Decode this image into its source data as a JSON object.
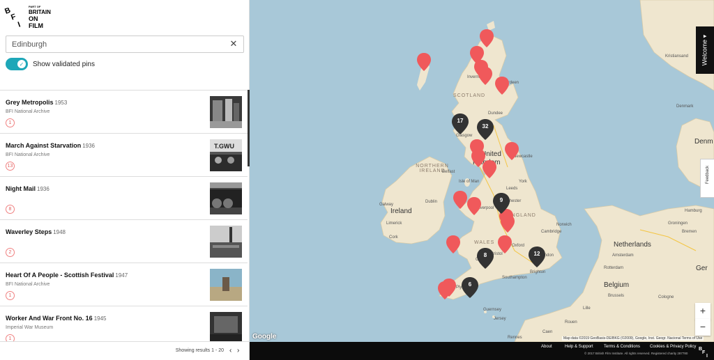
{
  "logo": {
    "top": "PART OF",
    "lines": [
      "BRITAIN",
      "ON",
      "FILM"
    ],
    "bfi": "BFI"
  },
  "search": {
    "value": "Edinburgh",
    "clear_icon": "close-icon"
  },
  "toggle": {
    "label": "Show validated pins",
    "on": true
  },
  "results": [
    {
      "title": "Grey Metropolis",
      "year": "1953",
      "source": "BFI National Archive",
      "count": "1"
    },
    {
      "title": "March Against Starvation",
      "year": "1936",
      "source": "BFI National Archive",
      "count": "13"
    },
    {
      "title": "Night Mail",
      "year": "1936",
      "source": "",
      "count": "8"
    },
    {
      "title": "Waverley Steps",
      "year": "1948",
      "source": "",
      "count": "2"
    },
    {
      "title": "Heart Of A People - Scottish Festival",
      "year": "1947",
      "source": "BFI National Archive",
      "count": "1"
    },
    {
      "title": "Worker And War Front No. 16",
      "year": "1945",
      "source": "Imperial War Museum",
      "count": "1"
    }
  ],
  "pagination": {
    "showing": "Showing results 1 - 20",
    "prev": "‹",
    "next": "›"
  },
  "collapse": "◂",
  "map": {
    "labels": {
      "scotland": "SCOTLAND",
      "glasgow": "Glasgow",
      "edinburgh": "Ed",
      "united_kingdom": "United",
      "kingdom": "Kingdom",
      "northern_ireland": "NORTHERN IRELAND",
      "isle_of_man": "Isle of Man",
      "ireland": "Ireland",
      "dublin": "Dublin",
      "galway": "Galway",
      "leeds": "Leeds",
      "manchester": "Manchester",
      "liverpool": "Liverpool",
      "england": "ENGLAND",
      "wales": "WALES",
      "cambridge": "Cambridge",
      "oxford": "Oxford",
      "london": "London",
      "southampton": "Southampton",
      "brighton": "Brighton",
      "guernsey": "Guernsey",
      "jersey": "Jersey",
      "caen": "Caen",
      "denmark": "Denm",
      "netherlands": "Netherlands",
      "belgium": "Belgium",
      "amsterdam": "Amsterdam",
      "brussels": "Brussels",
      "hamburg": "Hamburg",
      "german": "Ger",
      "rouen": "Rouen",
      "rennes": "Rennes",
      "norway_city": "Kristiansand",
      "aberdeen": "Aberdeen",
      "inverness": "Inverness",
      "cork": "Cork",
      "limerick": "Limerick",
      "belfast": "Belfast",
      "york": "York",
      "cardiff": "Cardiff",
      "bristol": "Bristol",
      "plymouth": "Plymouth",
      "dundee": "Dundee",
      "newcastle": "Newcastle",
      "norwich": "Norwich",
      "lille": "Lille",
      "groningen": "Groningen",
      "denmark_b": "Denmark",
      "rotterdam": "Rotterdam",
      "bremen": "Bremen",
      "cologne": "Cologne"
    },
    "clusters": [
      "17",
      "32",
      "9",
      "8",
      "12",
      "6"
    ],
    "welcome": "Welcome ▾",
    "feedback": "Feedback",
    "zoom_in": "+",
    "zoom_out": "−",
    "google": "Google",
    "attribution": "Map data ©2019 GeoBasis-DE/BKG (©2009), Google, Inst. Geogr. Nacional   Terms of Use"
  },
  "footer": {
    "links": [
      "About",
      "Help & Support",
      "Terms & Conditions",
      "Cookies & Privacy Policy"
    ],
    "copyright": "© 2017 British Film Institute. All rights reserved. Registered charity 287780"
  },
  "colors": {
    "accent": "#1ea7b8",
    "pin": "#f0595b",
    "cluster": "#333333",
    "land": "#efe6cf",
    "water": "#a8c8d8"
  }
}
